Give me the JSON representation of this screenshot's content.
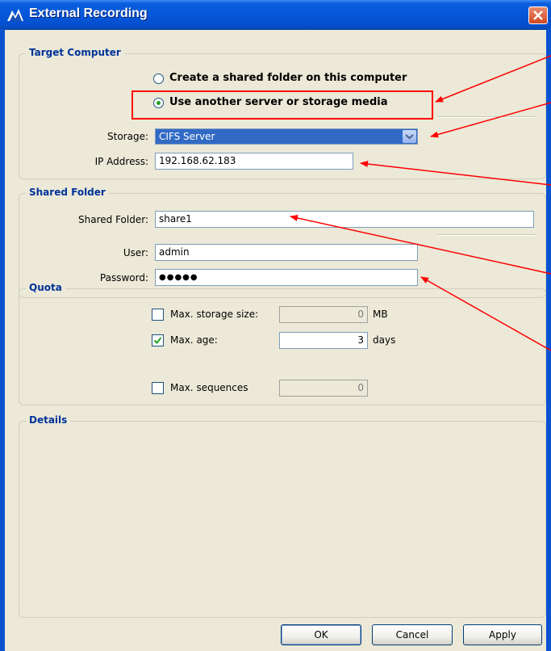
{
  "window": {
    "title": "External Recording"
  },
  "target_computer": {
    "legend": "Target Computer",
    "option_create_label": "Create a shared folder on this computer",
    "option_use_label": "Use another server or storage media",
    "storage_label": "Storage:",
    "storage_value": "CIFS Server",
    "ip_label": "IP Address:",
    "ip_value": "192.168.62.183"
  },
  "shared_folder": {
    "legend": "Shared Folder",
    "folder_label": "Shared Folder:",
    "folder_value": "share1",
    "user_label": "User:",
    "user_value": "admin",
    "password_label": "Password:",
    "password_value": "●●●●●"
  },
  "quota": {
    "legend": "Quota",
    "max_storage_label": "Max. storage size:",
    "max_storage_value": "0",
    "max_storage_unit": "MB",
    "max_storage_checked": false,
    "max_age_label": "Max. age:",
    "max_age_value": "3",
    "max_age_unit": "days",
    "max_age_checked": true,
    "max_sequences_label": "Max. sequences",
    "max_sequences_value": "0",
    "max_sequences_checked": false
  },
  "details": {
    "legend": "Details"
  },
  "buttons": {
    "ok": "OK",
    "cancel": "Cancel",
    "apply": "Apply"
  },
  "colors": {
    "titlebar": "#0656d8",
    "legend_text": "#003399",
    "annotation": "#ff0000",
    "selection": "#316ac5"
  },
  "icons": {
    "app": "app-logo-icon",
    "close": "close-icon",
    "dropdown": "chevron-down-icon",
    "check": "check-icon"
  }
}
